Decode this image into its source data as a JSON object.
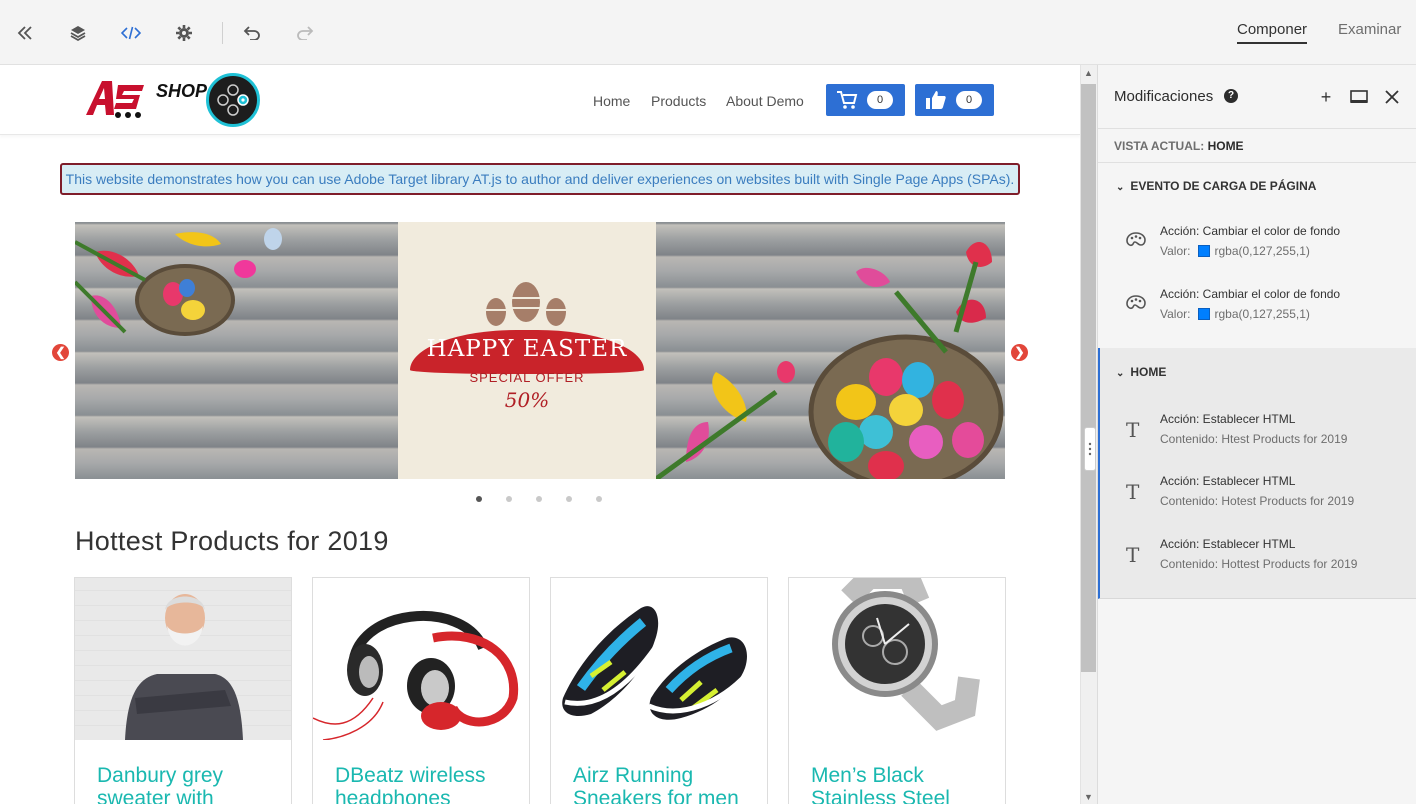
{
  "toolbar": {
    "tabs": [
      {
        "label": "Componer",
        "active": true
      },
      {
        "label": "Examinar",
        "active": false
      }
    ],
    "icons": [
      "collapse-icon",
      "layers-icon",
      "code-icon",
      "settings-icon",
      "undo-icon",
      "redo-icon"
    ]
  },
  "site": {
    "logo_text": "SHOP",
    "nav": [
      "Home",
      "Products",
      "About Demo"
    ],
    "cart_count": "0",
    "likes_count": "0",
    "notice": "This website demonstrates how you can use Adobe Target library AT.js to author and deliver experiences on websites built with Single Page Apps (SPAs).",
    "banner": {
      "headline": "HAPPY EASTER",
      "subline": "SPECIAL OFFER",
      "discount": "50%"
    },
    "section_title": "Hottest Products for 2019",
    "products": [
      {
        "title": "Danbury grey sweater with"
      },
      {
        "title": "DBeatz wireless headphones"
      },
      {
        "title": "Airz Running Sneakers for men"
      },
      {
        "title": "Men’s Black Stainless Steel"
      }
    ]
  },
  "panel": {
    "title": "Modificaciones",
    "current_view_label": "VISTA ACTUAL:",
    "current_view_value": "HOME",
    "groups": [
      {
        "name": "EVENTO DE CARGA DE PÁGINA",
        "actions": [
          {
            "action": "Acción: Cambiar el color de fondo",
            "detail_label": "Valor:",
            "detail_value": "rgba(0,127,255,1)",
            "icon": "palette-icon"
          },
          {
            "action": "Acción: Cambiar el color de fondo",
            "detail_label": "Valor:",
            "detail_value": "rgba(0,127,255,1)",
            "icon": "palette-icon"
          }
        ]
      },
      {
        "name": "HOME",
        "actions": [
          {
            "action": "Acción: Establecer HTML",
            "detail": "Contenido: Htest Products for 2019",
            "icon": "text-icon"
          },
          {
            "action": "Acción: Establecer HTML",
            "detail": "Contenido: Hotest Products for 2019",
            "icon": "text-icon"
          },
          {
            "action": "Acción: Establecer HTML",
            "detail": "Contenido: Hottest Products for 2019",
            "icon": "text-icon"
          }
        ]
      }
    ]
  },
  "colors": {
    "accent_blue": "#2d6fd4",
    "swatch": "#007fff",
    "product_title": "#1ab8b0",
    "notice_border": "#7f1d2a",
    "arrow_red": "#e2463a"
  }
}
